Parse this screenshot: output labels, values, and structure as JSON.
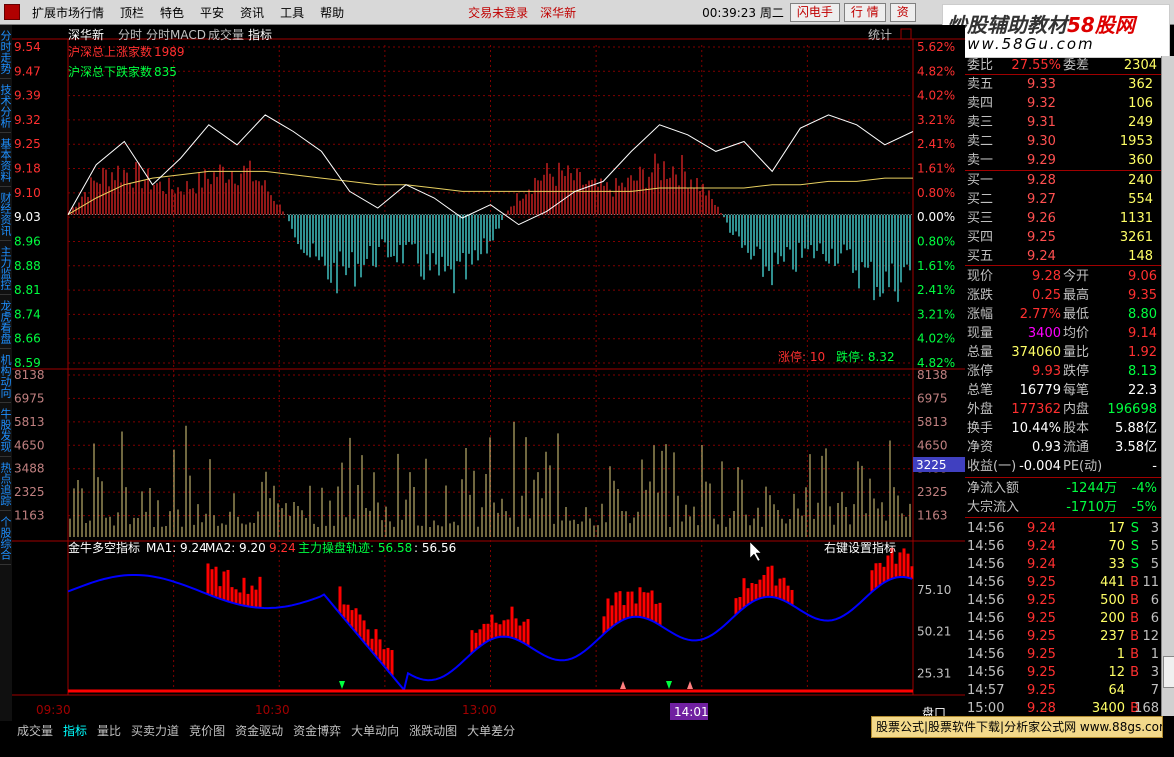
{
  "menu": {
    "items": [
      "扩展市场行情",
      "顶栏",
      "特色",
      "平安",
      "资讯",
      "工具",
      "帮助"
    ],
    "status_login": "交易未登录",
    "status_stock": "深华新",
    "clock": "00:39:23 周二",
    "btn_flash": "闪电手",
    "btn_quote": "行  情",
    "btn_trade": "资"
  },
  "watermark": {
    "line1a": "炒股辅助教材",
    "line1b": "58股网",
    "line2": "www.58Gu.com"
  },
  "left_tabs": [
    "分时走势",
    "技术分析",
    "基本资料",
    "财经资讯",
    "主力监控",
    "龙虎看盘",
    "机构动向",
    "牛股发现",
    "热点追踪",
    "个股综合"
  ],
  "chart": {
    "stock_name": "深华新",
    "tabs": [
      "分时",
      "分时MACD",
      "成交量",
      "指标"
    ],
    "stats_btn": "统计",
    "adv_label": "沪深总上涨家数",
    "adv_value": "1989",
    "dec_label": "沪深总下跌家数",
    "dec_value": "835",
    "price_ticks": [
      "9.54",
      "9.47",
      "9.39",
      "9.32",
      "9.25",
      "9.18",
      "9.10",
      "9.03",
      "8.96",
      "8.88",
      "8.81",
      "8.74",
      "8.66",
      "8.59"
    ],
    "pct_ticks": [
      "5.62%",
      "4.82%",
      "4.02%",
      "3.21%",
      "2.41%",
      "1.61%",
      "0.80%",
      "0.00%",
      "0.80%",
      "1.61%",
      "2.41%",
      "3.21%",
      "4.02%",
      "4.82%"
    ],
    "vol_ticks": [
      "8138",
      "6975",
      "5813",
      "4650",
      "3488",
      "2325",
      "1163"
    ],
    "vol_current": "3225",
    "limit_up_label": "涨停: 10",
    "limit_down_label": "跌停: 8.32",
    "ind_title": "金牛多空指标",
    "ind_ma1": "MA1: 9.24",
    "ind_ma2": "MA2: 9.20",
    "ind_val": "9.24",
    "ind_track": "主力操盘轨迹: 56.58",
    "ind_track2": ": 56.56",
    "ind_right": "右键设置指标",
    "ind_ticks": [
      "75.10",
      "50.21",
      "25.31"
    ],
    "time_labels": [
      "09:30",
      "10:30",
      "13:00",
      "14:01"
    ],
    "corner_label": "盘口",
    "sell_labels": [
      "卖出"
    ],
    "buy_labels": [
      "买入"
    ]
  },
  "chart_data": {
    "type": "line",
    "title": "深华新",
    "series": [
      {
        "name": "price",
        "values": [
          9.03,
          9.18,
          9.25,
          9.12,
          9.2,
          9.3,
          9.24,
          9.33,
          9.28,
          9.22,
          9.1,
          9.05,
          9.12,
          9.08,
          9.02,
          9.06,
          9.0,
          9.04,
          9.1,
          9.13,
          9.22,
          9.3,
          9.27,
          9.22,
          9.25,
          9.16,
          9.29,
          9.33,
          9.3,
          9.24,
          9.28
        ]
      },
      {
        "name": "avg",
        "values": [
          9.03,
          9.08,
          9.12,
          9.14,
          9.15,
          9.16,
          9.16,
          9.16,
          9.15,
          9.14,
          9.13,
          9.12,
          9.12,
          9.11,
          9.1,
          9.1,
          9.1,
          9.1,
          9.1,
          9.1,
          9.1,
          9.11,
          9.11,
          9.11,
          9.11,
          9.12,
          9.12,
          9.13,
          9.13,
          9.14,
          9.14
        ]
      }
    ],
    "ylim": [
      8.59,
      9.54
    ]
  },
  "quote": {
    "weibi_label": "委比",
    "weibi_val": "27.55%",
    "weicha_label": "委差",
    "weicha_val": "2304",
    "sell": [
      {
        "label": "卖五",
        "price": "9.33",
        "vol": "362"
      },
      {
        "label": "卖四",
        "price": "9.32",
        "vol": "106"
      },
      {
        "label": "卖三",
        "price": "9.31",
        "vol": "249"
      },
      {
        "label": "卖二",
        "price": "9.30",
        "vol": "1953"
      },
      {
        "label": "卖一",
        "price": "9.29",
        "vol": "360"
      }
    ],
    "buy": [
      {
        "label": "买一",
        "price": "9.28",
        "vol": "240"
      },
      {
        "label": "买二",
        "price": "9.27",
        "vol": "554"
      },
      {
        "label": "买三",
        "price": "9.26",
        "vol": "1131"
      },
      {
        "label": "买四",
        "price": "9.25",
        "vol": "3261"
      },
      {
        "label": "买五",
        "price": "9.24",
        "vol": "148"
      }
    ],
    "stats": [
      {
        "l1": "现价",
        "v1": "9.28",
        "c1": "red",
        "l2": "今开",
        "v2": "9.06",
        "c2": "red"
      },
      {
        "l1": "涨跌",
        "v1": "0.25",
        "c1": "red",
        "l2": "最高",
        "v2": "9.35",
        "c2": "red"
      },
      {
        "l1": "涨幅",
        "v1": "2.77%",
        "c1": "red",
        "l2": "最低",
        "v2": "8.80",
        "c2": "green"
      },
      {
        "l1": "现量",
        "v1": "3400",
        "c1": "purple",
        "l2": "均价",
        "v2": "9.14",
        "c2": "red"
      },
      {
        "l1": "总量",
        "v1": "374060",
        "c1": "yellow",
        "l2": "量比",
        "v2": "1.92",
        "c2": "red"
      },
      {
        "l1": "涨停",
        "v1": "9.93",
        "c1": "red",
        "l2": "跌停",
        "v2": "8.13",
        "c2": "green"
      },
      {
        "l1": "总笔",
        "v1": "16779",
        "c1": "white",
        "l2": "每笔",
        "v2": "22.3",
        "c2": "white"
      },
      {
        "l1": "外盘",
        "v1": "177362",
        "c1": "red",
        "l2": "内盘",
        "v2": "196698",
        "c2": "green"
      },
      {
        "l1": "换手",
        "v1": "10.44%",
        "c1": "white",
        "l2": "股本",
        "v2": "5.88亿",
        "c2": "white"
      },
      {
        "l1": "净资",
        "v1": "0.93",
        "c1": "white",
        "l2": "流通",
        "v2": "3.58亿",
        "c2": "white"
      },
      {
        "l1": "收益(一)",
        "v1": "-0.004",
        "c1": "white",
        "l2": "PE(动)",
        "v2": "-",
        "c2": "white"
      }
    ],
    "flow1_label": "净流入额",
    "flow1_val": "-1244万",
    "flow1_pct": "-4%",
    "flow2_label": "大宗流入",
    "flow2_val": "-1710万",
    "flow2_pct": "-5%",
    "ticks": [
      {
        "t": "14:56",
        "p": "9.24",
        "pc": "red",
        "v": "17",
        "d": "S",
        "dc": "green",
        "n": "3"
      },
      {
        "t": "14:56",
        "p": "9.24",
        "pc": "red",
        "v": "70",
        "d": "S",
        "dc": "green",
        "n": "5"
      },
      {
        "t": "14:56",
        "p": "9.24",
        "pc": "red",
        "v": "33",
        "d": "S",
        "dc": "green",
        "n": "5"
      },
      {
        "t": "14:56",
        "p": "9.25",
        "pc": "red",
        "v": "441",
        "d": "B",
        "dc": "red",
        "n": "11"
      },
      {
        "t": "14:56",
        "p": "9.25",
        "pc": "red",
        "v": "500",
        "d": "B",
        "dc": "red",
        "n": "6"
      },
      {
        "t": "14:56",
        "p": "9.25",
        "pc": "red",
        "v": "200",
        "d": "B",
        "dc": "red",
        "n": "6"
      },
      {
        "t": "14:56",
        "p": "9.25",
        "pc": "red",
        "v": "237",
        "d": "B",
        "dc": "red",
        "n": "12"
      },
      {
        "t": "14:56",
        "p": "9.25",
        "pc": "red",
        "v": "1",
        "d": "B",
        "dc": "red",
        "n": "1"
      },
      {
        "t": "14:56",
        "p": "9.25",
        "pc": "red",
        "v": "12",
        "d": "B",
        "dc": "red",
        "n": "3"
      },
      {
        "t": "14:57",
        "p": "9.25",
        "pc": "red",
        "v": "64",
        "d": "",
        "dc": "red",
        "n": "7"
      },
      {
        "t": "15:00",
        "p": "9.28",
        "pc": "red",
        "v": "3400",
        "d": "B",
        "dc": "red",
        "n": "168"
      }
    ]
  },
  "bottom_tabs": [
    "成交量",
    "指标",
    "量比",
    "买卖力道",
    "竞价图",
    "资金驱动",
    "资金博弈",
    "大单动向",
    "涨跌动图",
    "大单差分"
  ],
  "ad_text": "股票公式|股票软件下载|分析家公式网 www.88gs.com"
}
